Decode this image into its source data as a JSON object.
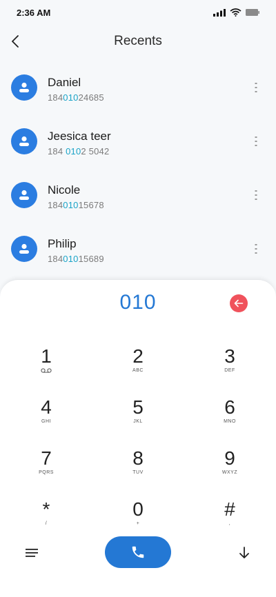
{
  "status_bar": {
    "time": "2:36 AM",
    "icons": [
      "signal-icon",
      "wifi-icon",
      "battery-icon"
    ]
  },
  "header": {
    "title": "Recents",
    "back_icon": "back-arrow-icon"
  },
  "recents": [
    {
      "name": "Daniel",
      "number_pre": "184",
      "number_match": "010",
      "number_post": "24685"
    },
    {
      "name": "Jeesica teer",
      "number_pre": "184 ",
      "number_match": "010",
      "number_post": "2 5042"
    },
    {
      "name": "Nicole",
      "number_pre": "184",
      "number_match": "010",
      "number_post": "15678"
    },
    {
      "name": "Philip",
      "number_pre": "184",
      "number_match": "010",
      "number_post": "15689"
    }
  ],
  "dialer": {
    "entered": "010",
    "keys": [
      {
        "digit": "1",
        "letters": "voicemail-icon"
      },
      {
        "digit": "2",
        "letters": "ABC"
      },
      {
        "digit": "3",
        "letters": "DEF"
      },
      {
        "digit": "4",
        "letters": "GHI"
      },
      {
        "digit": "5",
        "letters": "JKL"
      },
      {
        "digit": "6",
        "letters": "MNO"
      },
      {
        "digit": "7",
        "letters": "PQRS"
      },
      {
        "digit": "8",
        "letters": "TUV"
      },
      {
        "digit": "9",
        "letters": "WXYZ"
      },
      {
        "digit": "*",
        "letters": "/"
      },
      {
        "digit": "0",
        "letters": "+"
      },
      {
        "digit": "#",
        "letters": ","
      }
    ]
  },
  "colors": {
    "accent": "#2478d4",
    "highlight": "#1aa3c7",
    "backspace": "#f0525c",
    "avatar": "#2b7de1"
  }
}
